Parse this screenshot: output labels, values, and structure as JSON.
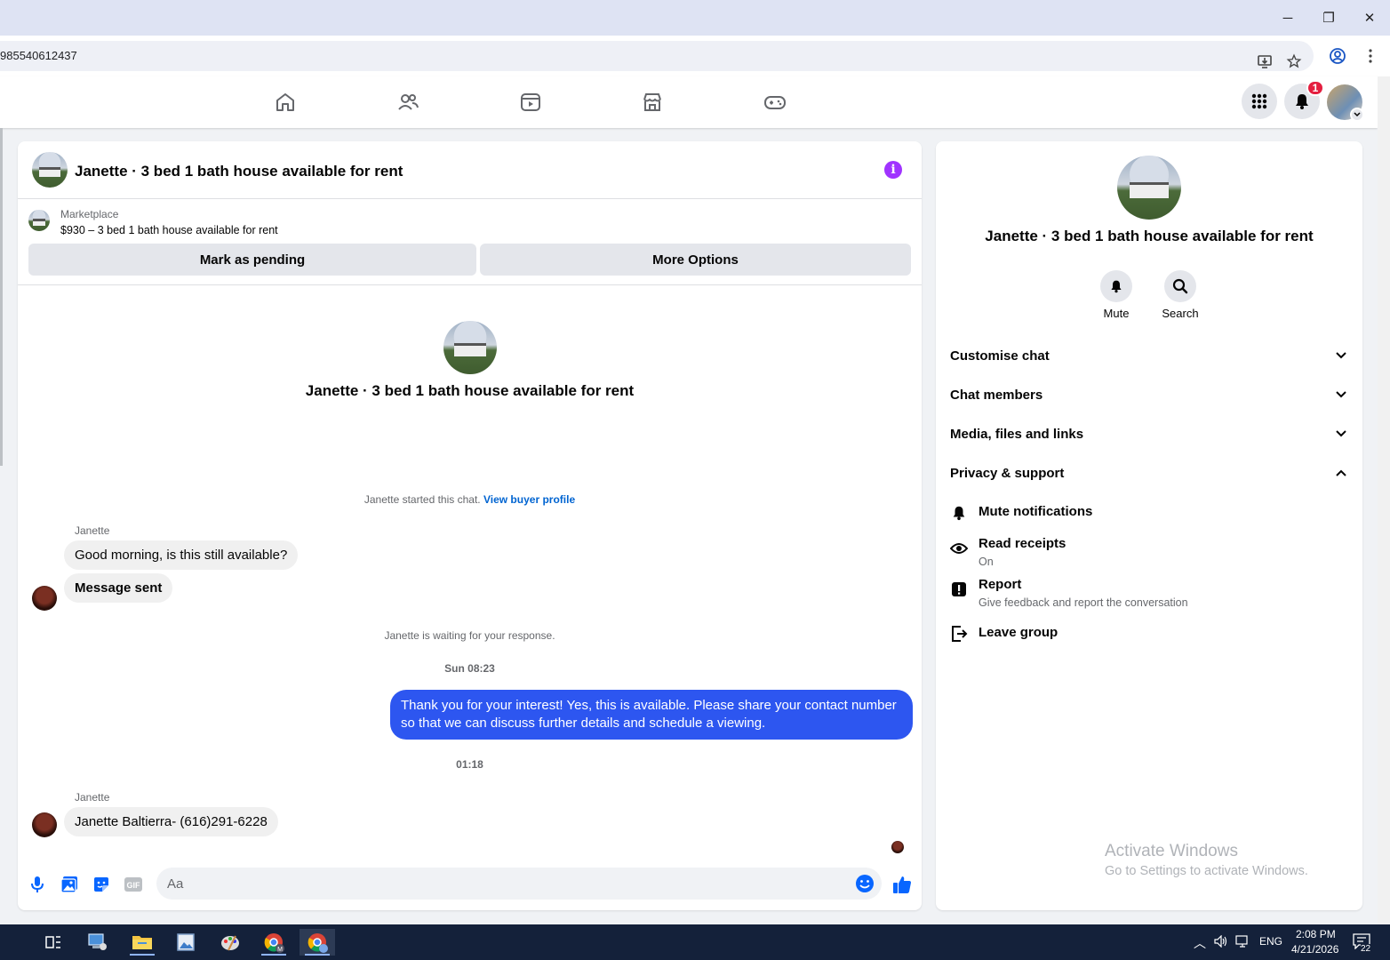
{
  "browser": {
    "url_fragment": "985540612437",
    "window_controls": {
      "minimize": "─",
      "restore": "❐",
      "close": "✕"
    }
  },
  "fb_nav": {
    "tabs": [
      "home-icon",
      "friends-icon",
      "watch-icon",
      "marketplace-icon",
      "gaming-icon"
    ],
    "notification_count": "1"
  },
  "chat": {
    "header_title": "Janette · 3 bed 1 bath house available for rent",
    "marketplace_label": "Marketplace",
    "listing_text": "$930 – 3 bed 1 bath house available for rent",
    "mark_pending_label": "Mark as pending",
    "more_options_label": "More Options",
    "center_name": "Janette · 3 bed 1 bath house available for rent",
    "started_text": "Janette started this chat.",
    "view_buyer_profile": "View buyer profile",
    "waiting_text": "Janette is waiting for your response.",
    "messages": [
      {
        "sender": "Janette",
        "text": "Good morning, is this still available?"
      },
      {
        "text": "Message sent"
      },
      {
        "timestamp": "Sun 08:23"
      },
      {
        "outgoing": "Thank you for your interest! Yes, this is available. Please share your contact number so that we can discuss further details and schedule a viewing."
      },
      {
        "timestamp": "01:18"
      },
      {
        "sender": "Janette",
        "text": "Janette Baltierra- (616)291-6228"
      }
    ],
    "composer_placeholder": "Aa"
  },
  "info_panel": {
    "name": "Janette · 3 bed 1 bath house available for rent",
    "actions": [
      "Mute",
      "Search"
    ],
    "sections": [
      "Customise chat",
      "Chat members",
      "Media, files and links",
      "Privacy & support"
    ],
    "privacy_options": [
      {
        "title": "Mute notifications",
        "sub": ""
      },
      {
        "title": "Read receipts",
        "sub": "On"
      },
      {
        "title": "Report",
        "sub": "Give feedback and report the conversation"
      },
      {
        "title": "Leave group",
        "sub": ""
      }
    ],
    "watermark_title": "Activate Windows",
    "watermark_sub": "Go to Settings to activate Windows."
  },
  "taskbar": {
    "language": "ENG",
    "time": "2:08 PM",
    "date": "4/21/2026",
    "notifications": "22"
  }
}
